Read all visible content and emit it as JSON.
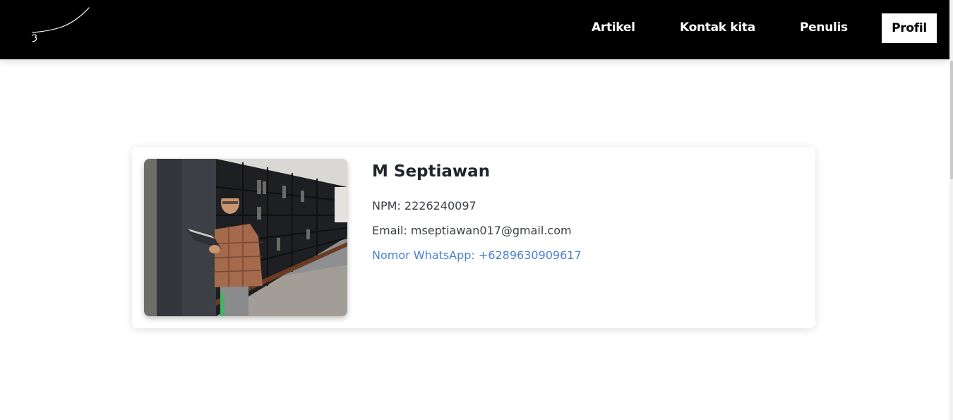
{
  "nav": {
    "logo_icon": "signature-logo-icon",
    "items": [
      {
        "label": "Artikel"
      },
      {
        "label": "Kontak kita"
      },
      {
        "label": "Penulis"
      },
      {
        "label": "Profil",
        "active": true
      }
    ]
  },
  "profile": {
    "photo_icon": "profile-photo",
    "name": "M Septiawan",
    "npm": "NPM: 2226240097",
    "email": "Email: mseptiawan017@gmail.com",
    "whatsapp": "Nomor WhatsApp: +6289630909617"
  },
  "colors": {
    "navbar_bg": "#000000",
    "link_blue": "#4a7fd6",
    "text_dark": "#212529"
  }
}
